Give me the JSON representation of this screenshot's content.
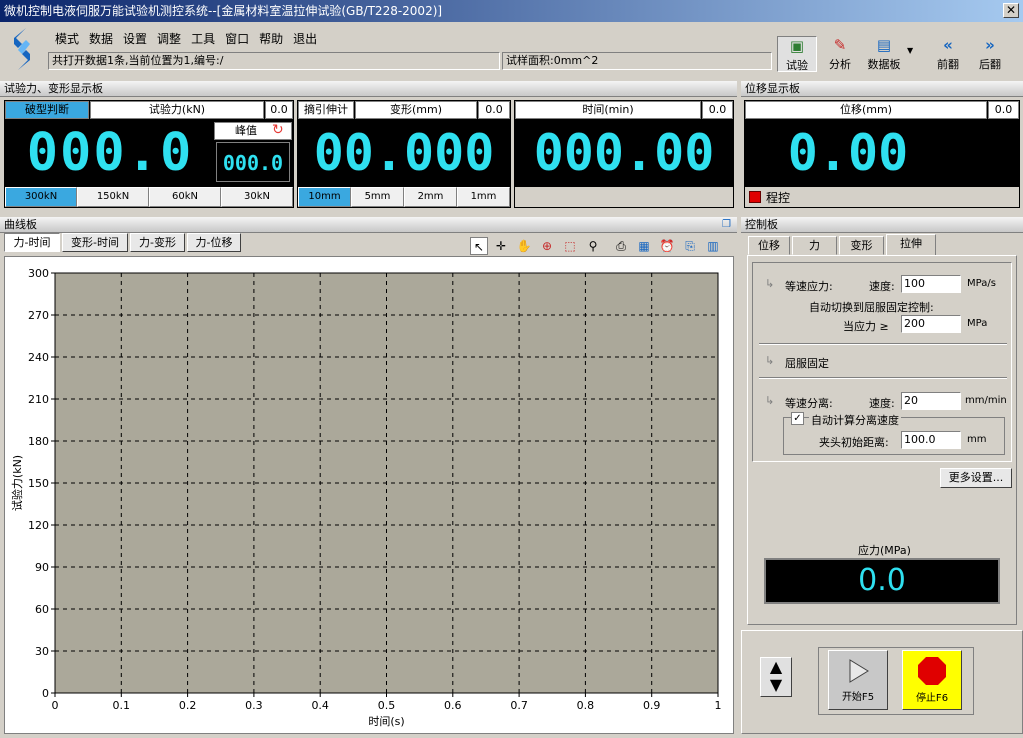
{
  "window": {
    "title": "微机控制电液伺服万能试验机测控系统--[金属材料室温拉伸试验(GB/T228-2002)]"
  },
  "menu": [
    "模式",
    "数据",
    "设置",
    "调整",
    "工具",
    "窗口",
    "帮助",
    "退出"
  ],
  "info": {
    "record": "共打开数据1条,当前位置为1,编号:/",
    "area": "试样面积:0mm^2"
  },
  "toolbar": {
    "test": "试验",
    "analyze": "分析",
    "databoard": "数据板",
    "prev": "前翻",
    "next": "后翻"
  },
  "panels": {
    "force_deform": "试验力、变形显示板",
    "displacement": "位移显示板",
    "curve": "曲线板",
    "control": "控制板"
  },
  "force": {
    "mode": "破型判断",
    "label": "试验力(kN)",
    "small": "0.0",
    "value": "000.0",
    "peak_label": "峰值",
    "peak_value": "000.0",
    "ranges": [
      "300kN",
      "150kN",
      "60kN",
      "30kN"
    ]
  },
  "deform": {
    "mode": "摘引伸计",
    "label": "变形(mm)",
    "small": "0.0",
    "value": "00.000",
    "ranges": [
      "10mm",
      "5mm",
      "2mm",
      "1mm"
    ]
  },
  "time": {
    "label": "时间(min)",
    "small": "0.0",
    "value": "000.00"
  },
  "disp": {
    "label": "位移(mm)",
    "small": "0.0",
    "value": "0.00",
    "program": "程控"
  },
  "curve_tabs": [
    "力-时间",
    "变形-时间",
    "力-变形",
    "力-位移"
  ],
  "control_tabs": [
    "位移",
    "力",
    "变形",
    "拉伸"
  ],
  "control": {
    "step1_label": "等速应力:",
    "speed_label": "速度:",
    "step1_speed": "100",
    "step1_unit": "MPa/s",
    "auto_switch": "自动切换到屈服固定控制:",
    "cond_label": "当应力 ≥",
    "cond_value": "200",
    "cond_unit": "MPa",
    "step2_label": "屈服固定",
    "step3_label": "等速分离:",
    "step3_speed": "20",
    "step3_unit": "mm/min",
    "auto_calc": "自动计算分离速度",
    "init_dist_label": "夹头初始距离:",
    "init_dist": "100.0",
    "init_dist_unit": "mm",
    "more": "更多设置...",
    "stress_label": "应力(MPa)",
    "stress_value": "0.0"
  },
  "run": {
    "start": "开始F5",
    "stop": "停止F6"
  },
  "colors": {
    "plot_bg": "#aba89a",
    "digit": "#2fe0f0",
    "select": "#3aa8e0",
    "stop": "#ffff00"
  },
  "chart_data": {
    "type": "line",
    "title": "",
    "xlabel": "时间(s)",
    "ylabel": "试验力(kN)",
    "xlim": [
      0,
      1
    ],
    "ylim": [
      0,
      300
    ],
    "x_ticks": [
      "0",
      "0.1",
      "0.2",
      "0.3",
      "0.4",
      "0.5",
      "0.6",
      "0.7",
      "0.8",
      "0.9",
      "1"
    ],
    "y_ticks": [
      "0",
      "30",
      "60",
      "90",
      "120",
      "150",
      "180",
      "210",
      "240",
      "270",
      "300"
    ],
    "grid": true,
    "series": []
  }
}
